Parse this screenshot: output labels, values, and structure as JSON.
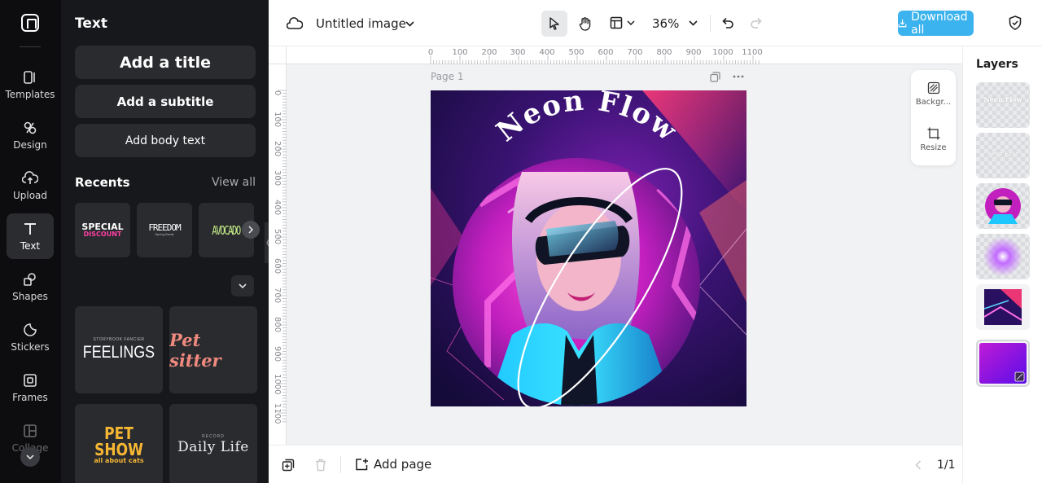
{
  "rail": {
    "items": [
      {
        "label": "Templates",
        "icon": "templates-icon"
      },
      {
        "label": "Design",
        "icon": "design-icon"
      },
      {
        "label": "Upload",
        "icon": "upload-icon"
      },
      {
        "label": "Text",
        "icon": "text-icon"
      },
      {
        "label": "Shapes",
        "icon": "shapes-icon"
      },
      {
        "label": "Stickers",
        "icon": "stickers-icon"
      },
      {
        "label": "Frames",
        "icon": "frames-icon"
      },
      {
        "label": "Collage",
        "icon": "collage-icon"
      }
    ],
    "active": "Text"
  },
  "panel": {
    "title": "Text",
    "add_title": "Add a title",
    "add_subtitle": "Add a subtitle",
    "add_body": "Add body text",
    "recents_label": "Recents",
    "view_all": "View all",
    "recents": [
      {
        "line1": "SPECIAL",
        "line2": "DISCOUNT"
      },
      {
        "line1": "FREEDOM",
        "line2": "Spring Break"
      },
      {
        "line1": "AVOCADO",
        "line2": ""
      }
    ],
    "templates": [
      {
        "line1": "FEELINGS",
        "line2": "STORYBOOK FANCIER"
      },
      {
        "line1": "Pet sitter",
        "line2": ""
      },
      {
        "line1": "PET SHOW",
        "line2": "all about cats"
      },
      {
        "line1": "Daily Life",
        "line2": "RECORD"
      }
    ]
  },
  "topbar": {
    "doc_title": "Untitled image",
    "zoom": "36%",
    "download_label": "Download all"
  },
  "workspace": {
    "page_label": "Page 1",
    "canvas_headline": "Neon Flow",
    "ruler_top": [
      "0",
      "100",
      "200",
      "300",
      "400",
      "500",
      "600",
      "700",
      "800",
      "900",
      "1000",
      "1100"
    ],
    "ruler_left": [
      "0",
      "100",
      "200",
      "300",
      "400",
      "500",
      "600",
      "700",
      "800",
      "900",
      "1000",
      "1100"
    ],
    "float_panel": {
      "background_label": "Backgr...",
      "resize_label": "Resize"
    }
  },
  "bottombar": {
    "add_page_label": "Add page",
    "page_count": "1/1"
  },
  "layers": {
    "title": "Layers",
    "thumb_texts": [
      "Neon Flow",
      "Neon Flow"
    ]
  },
  "colors": {
    "accent": "#3bb3ee",
    "rail_bg": "#0d0d0f",
    "panel_bg": "#17181b",
    "canvas_magenta": "#e020c8",
    "canvas_cyan": "#22d3ee"
  }
}
